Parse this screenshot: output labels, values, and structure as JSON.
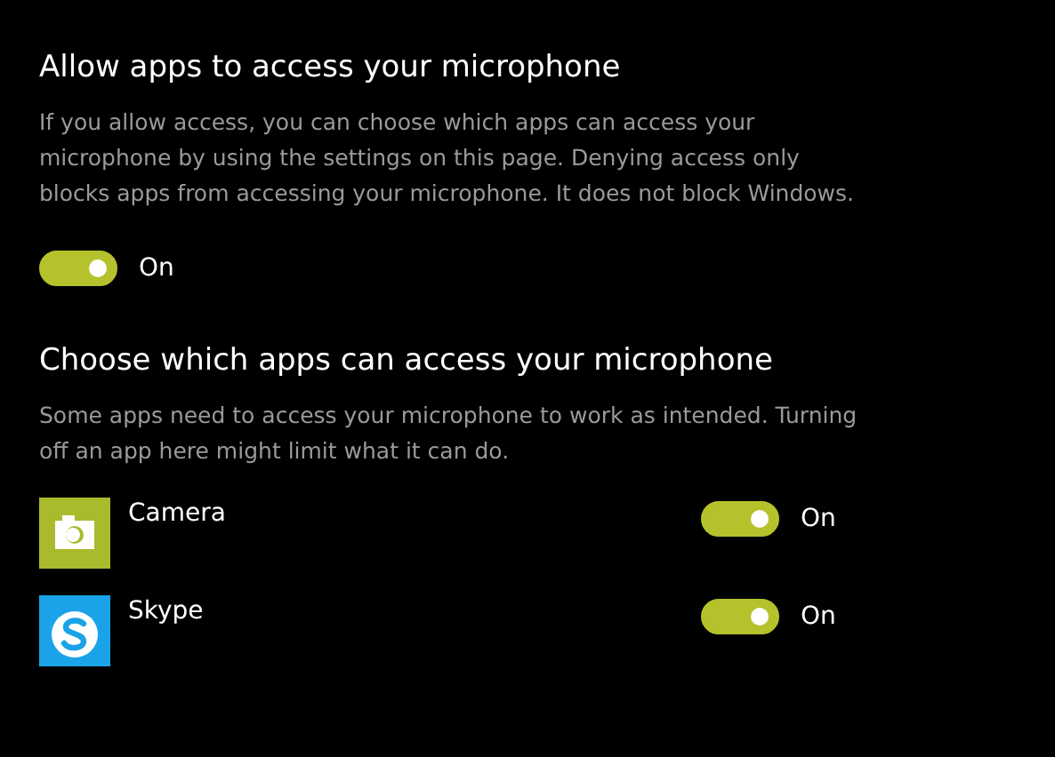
{
  "sections": [
    {
      "heading": "Allow apps to access your microphone",
      "description": "If you allow access, you can choose which apps can access your microphone by using the settings on this page. Denying access only blocks apps from accessing your microphone. It does not block Windows.",
      "toggle": {
        "on": true,
        "label": "On"
      }
    },
    {
      "heading": "Choose which apps can access your microphone",
      "description": "Some apps need to access your microphone to work as intended. Turning off an app here might limit what it can do.",
      "apps": [
        {
          "name": "Camera",
          "kind": "camera",
          "toggle": {
            "on": true,
            "label": "On"
          }
        },
        {
          "name": "Skype",
          "kind": "skype",
          "toggle": {
            "on": true,
            "label": "On"
          }
        }
      ]
    }
  ]
}
